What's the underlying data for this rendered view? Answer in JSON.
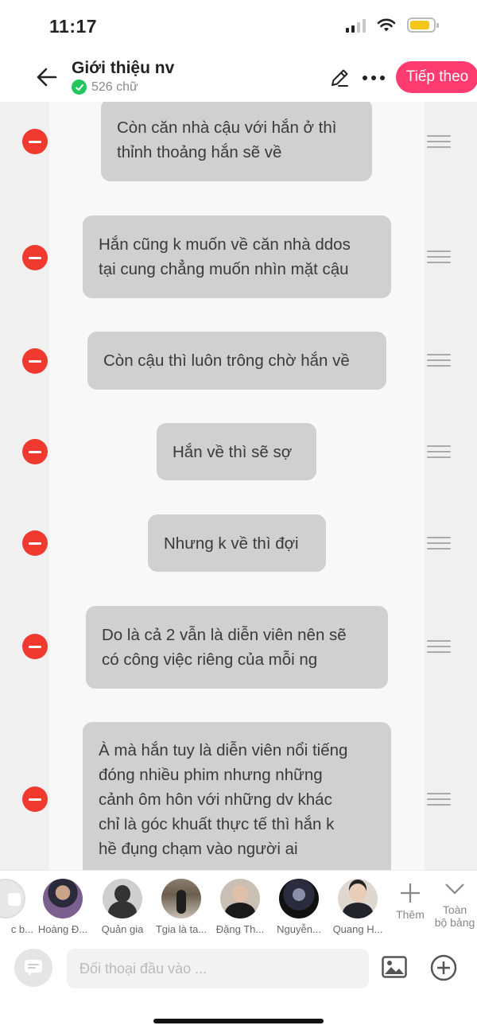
{
  "status_bar": {
    "time": "11:17"
  },
  "header": {
    "title": "Giới thiệu nv",
    "word_count": "526 chữ",
    "next_button": "Tiếp theo"
  },
  "messages": [
    {
      "text": "Còn căn nhà cậu với hắn ở thì\nthỉnh thoảng hắn sẽ về"
    },
    {
      "text": "Hắn cũng k muốn về căn nhà ddos\ntại cung chẳng muốn nhìn mặt cậu"
    },
    {
      "text": "Còn cậu thì luôn trông chờ hắn về"
    },
    {
      "text": "Hắn về thì sẽ sợ"
    },
    {
      "text": "Nhưng k về thì đợi"
    },
    {
      "text": "Do là cả 2 vẫn là diễn viên nên sẽ\ncó công việc riêng của mỗi ng"
    },
    {
      "text": "À mà hắn tuy là diễn viên nổi tiếng\nđóng nhiều phim nhưng những\ncảnh ôm hôn với những dv khác\nchỉ là góc khuất thực tế thì hắn k\nhề đụng chạm vào người ai"
    }
  ],
  "characters": [
    {
      "name": "c b..."
    },
    {
      "name": "Hoàng Đ..."
    },
    {
      "name": "Quản gia"
    },
    {
      "name": "Tgia là ta..."
    },
    {
      "name": "Đặng Th..."
    },
    {
      "name": "Nguyễn..."
    },
    {
      "name": "Quang H..."
    }
  ],
  "toolbar": {
    "add_label": "Thêm",
    "all_label_line1": "Toàn",
    "all_label_line2": "bộ bảng"
  },
  "input": {
    "placeholder": "Đối thoại đầu vào ..."
  },
  "colors": {
    "accent": "#ff3b6f",
    "delete": "#f03a2f",
    "bubble": "#d0d0d0"
  }
}
